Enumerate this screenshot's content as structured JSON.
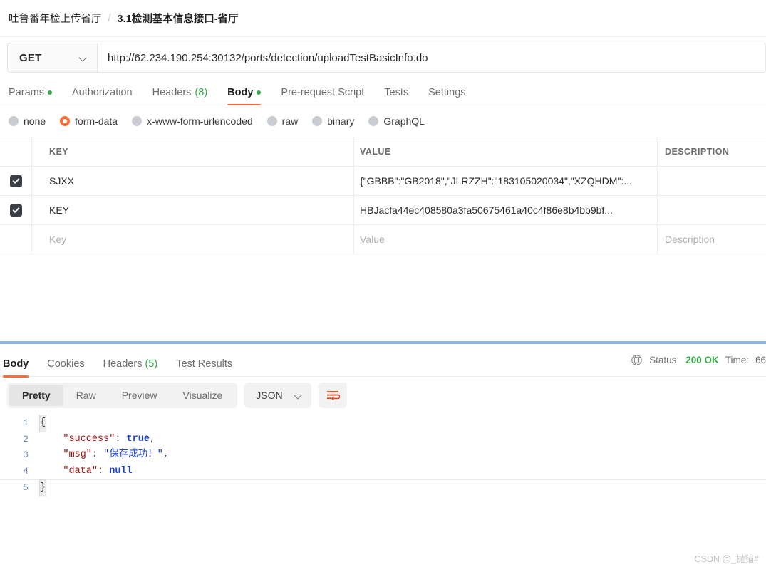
{
  "breadcrumb": {
    "parent": "吐鲁番年检上传省厅",
    "separator": "/",
    "current": "3.1检测基本信息接口-省厅"
  },
  "request": {
    "method": "GET",
    "url": "http://62.234.190.254:30132/ports/detection/uploadTestBasicInfo.do",
    "tabs": [
      {
        "label": "Params",
        "dot": true,
        "active": false
      },
      {
        "label": "Authorization",
        "dot": false,
        "active": false
      },
      {
        "label": "Headers",
        "count": "(8)",
        "active": false
      },
      {
        "label": "Body",
        "dot": true,
        "active": true
      },
      {
        "label": "Pre-request Script",
        "active": false
      },
      {
        "label": "Tests",
        "active": false
      },
      {
        "label": "Settings",
        "active": false
      }
    ],
    "body_types": [
      {
        "label": "none",
        "selected": false
      },
      {
        "label": "form-data",
        "selected": true
      },
      {
        "label": "x-www-form-urlencoded",
        "selected": false
      },
      {
        "label": "raw",
        "selected": false
      },
      {
        "label": "binary",
        "selected": false
      },
      {
        "label": "GraphQL",
        "selected": false
      }
    ],
    "table": {
      "headers": {
        "key": "KEY",
        "value": "VALUE",
        "description": "DESCRIPTION"
      },
      "rows": [
        {
          "checked": true,
          "key": "SJXX",
          "value": "{\"GBBB\":\"GB2018\",\"JLRZZH\":\"183105020034\",\"XZQHDM\":...",
          "description": ""
        },
        {
          "checked": true,
          "key": "KEY",
          "value": "HBJacfa44ec408580a3fa50675461a40c4f86e8b4bb9bf...",
          "description": ""
        }
      ],
      "placeholder_row": {
        "key": "Key",
        "value": "Value",
        "description": "Description"
      }
    }
  },
  "response": {
    "tabs": [
      {
        "label": "Body",
        "active": true
      },
      {
        "label": "Cookies",
        "active": false
      },
      {
        "label": "Headers",
        "count": "(5)",
        "active": false
      },
      {
        "label": "Test Results",
        "active": false
      }
    ],
    "status_label": "Status:",
    "status_value": "200 OK",
    "time_label": "Time:",
    "time_value": "66",
    "view_modes": [
      {
        "label": "Pretty",
        "active": true
      },
      {
        "label": "Raw",
        "active": false
      },
      {
        "label": "Preview",
        "active": false
      },
      {
        "label": "Visualize",
        "active": false
      }
    ],
    "format": "JSON",
    "body_lines": [
      {
        "n": "1",
        "segments": [
          {
            "t": "{",
            "c": "brace"
          }
        ]
      },
      {
        "n": "2",
        "segments": [
          {
            "t": "    ",
            "c": "pun"
          },
          {
            "t": "\"success\"",
            "c": "key"
          },
          {
            "t": ": ",
            "c": "pun"
          },
          {
            "t": "true",
            "c": "kw"
          },
          {
            "t": ",",
            "c": "pun"
          }
        ]
      },
      {
        "n": "3",
        "segments": [
          {
            "t": "    ",
            "c": "pun"
          },
          {
            "t": "\"msg\"",
            "c": "key"
          },
          {
            "t": ": ",
            "c": "pun"
          },
          {
            "t": "\"保存成功！\"",
            "c": "str"
          },
          {
            "t": ",",
            "c": "pun"
          }
        ]
      },
      {
        "n": "4",
        "segments": [
          {
            "t": "    ",
            "c": "pun"
          },
          {
            "t": "\"data\"",
            "c": "key"
          },
          {
            "t": ": ",
            "c": "pun"
          },
          {
            "t": "null",
            "c": "kw"
          }
        ]
      },
      {
        "n": "5",
        "segments": [
          {
            "t": "}",
            "c": "brace"
          }
        ]
      }
    ]
  },
  "watermark": "CSDN @_抛锚#",
  "colors": {
    "accent": "#ff6c37",
    "success": "#3aab4a",
    "divider": "#8ab7f0",
    "checkbox": "#3b3f45"
  }
}
